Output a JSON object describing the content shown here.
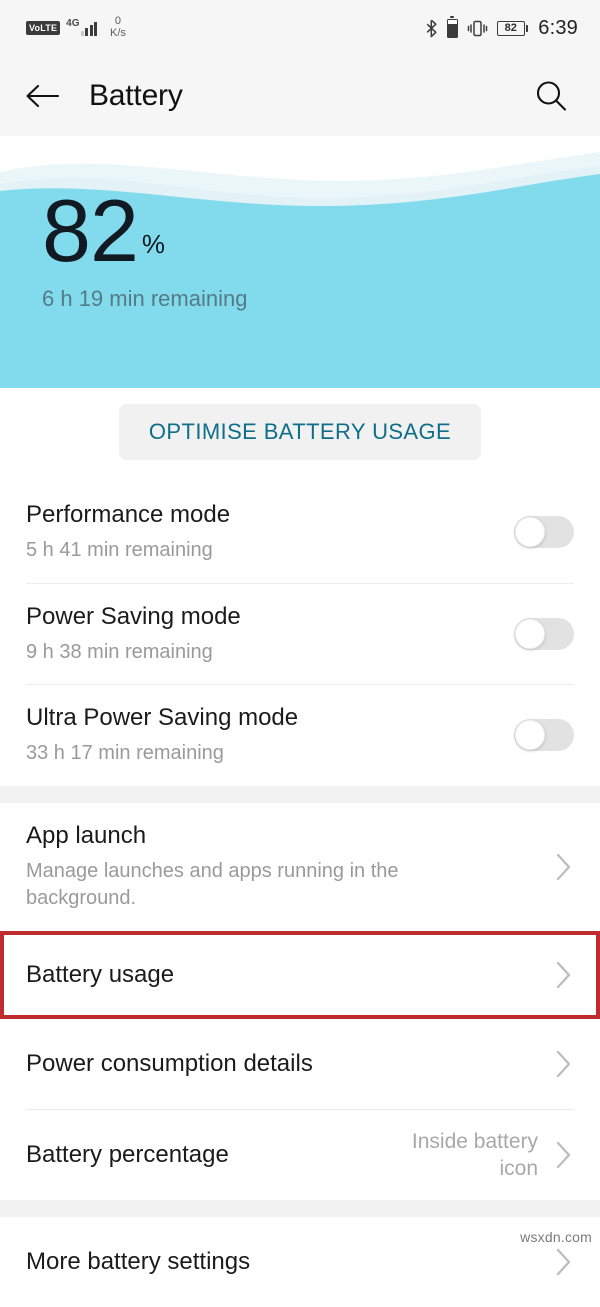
{
  "status_bar": {
    "volte_label": "VoLTE",
    "network_gen": "4G",
    "net_speed_value": "0",
    "net_speed_unit": "K/s",
    "bluetooth_icon": "bluetooth-icon",
    "battery_small_icon": "battery-icon",
    "vibrate_icon": "vibrate-icon",
    "battery_percent": "82",
    "clock": "6:39"
  },
  "app_bar": {
    "back_icon": "back-arrow-icon",
    "title": "Battery",
    "search_icon": "search-icon"
  },
  "hero": {
    "percent": "82",
    "percent_sign": "%",
    "remaining": "6 h 19 min remaining",
    "background_color": "#82dbec",
    "wave_color": "#eef7f9"
  },
  "optimise": {
    "label": "OPTIMISE BATTERY USAGE",
    "text_color": "#0f6f88",
    "bg_color": "#f1f1f1"
  },
  "modes": [
    {
      "title": "Performance mode",
      "sub": "5 h 41 min remaining",
      "toggle": "off"
    },
    {
      "title": "Power Saving mode",
      "sub": "9 h 38 min remaining",
      "toggle": "off"
    },
    {
      "title": "Ultra Power Saving mode",
      "sub": "33 h 17 min remaining",
      "toggle": "off"
    }
  ],
  "links": [
    {
      "title": "App launch",
      "sub": "Manage launches and apps running in the background.",
      "value": "",
      "highlighted": false
    },
    {
      "title": "Battery usage",
      "sub": "",
      "value": "",
      "highlighted": true
    },
    {
      "title": "Power consumption details",
      "sub": "",
      "value": "",
      "highlighted": false
    },
    {
      "title": "Battery percentage",
      "sub": "",
      "value": "Inside battery icon",
      "highlighted": false
    }
  ],
  "footer": {
    "title": "More battery settings"
  },
  "highlight_color": "#be2c30",
  "watermark": "wsxdn.com"
}
